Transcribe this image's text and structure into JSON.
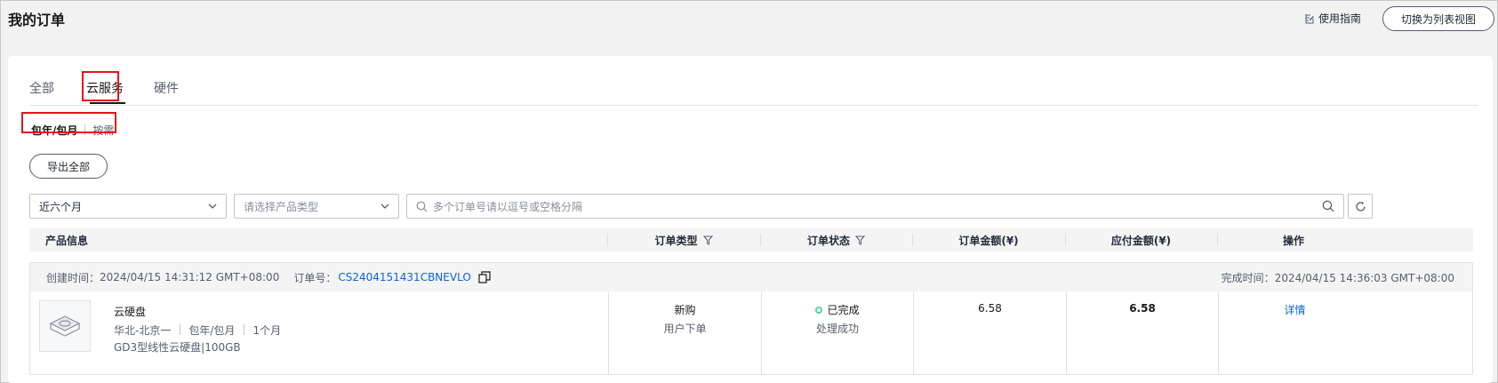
{
  "header": {
    "title": "我的订单",
    "guide_label": "使用指南",
    "switch_view_label": "切换为列表视图"
  },
  "tabs": [
    {
      "label": "全部",
      "active": false
    },
    {
      "label": "云服务",
      "active": true
    },
    {
      "label": "硬件",
      "active": false
    }
  ],
  "subtabs": [
    {
      "label": "包年/包月",
      "active": true
    },
    {
      "label": "按需",
      "active": false
    }
  ],
  "toolbar": {
    "export_label": "导出全部",
    "period_value": "近六个月",
    "product_type_placeholder": "请选择产品类型",
    "search_placeholder": "多个订单号请以逗号或空格分隔"
  },
  "table": {
    "columns": [
      "产品信息",
      "订单类型",
      "订单状态",
      "订单金额(¥)",
      "应付金额(¥)",
      "操作"
    ]
  },
  "orders": [
    {
      "created_label": "创建时间：",
      "created_time": "2024/04/15 14:31:12 GMT+08:00",
      "order_no_label": "订单号：",
      "order_no": "CS2404151431CBNEVLO",
      "completed_label": "完成时间：",
      "completed_time": "2024/04/15 14:36:03 GMT+08:00",
      "product_name": "云硬盘",
      "region": "华北-北京一",
      "billing": "包年/包月",
      "duration": "1个月",
      "spec": "GD3型线性云硬盘|100GB",
      "order_type": "新购",
      "order_type_sub": "用户下单",
      "status": "已完成",
      "status_sub": "处理成功",
      "order_amount": "6.58",
      "payable_amount": "6.58",
      "action": "详情"
    }
  ],
  "colors": {
    "link": "#0e62d7",
    "highlight": "#e4141b",
    "status_done": "#50d4ab"
  }
}
